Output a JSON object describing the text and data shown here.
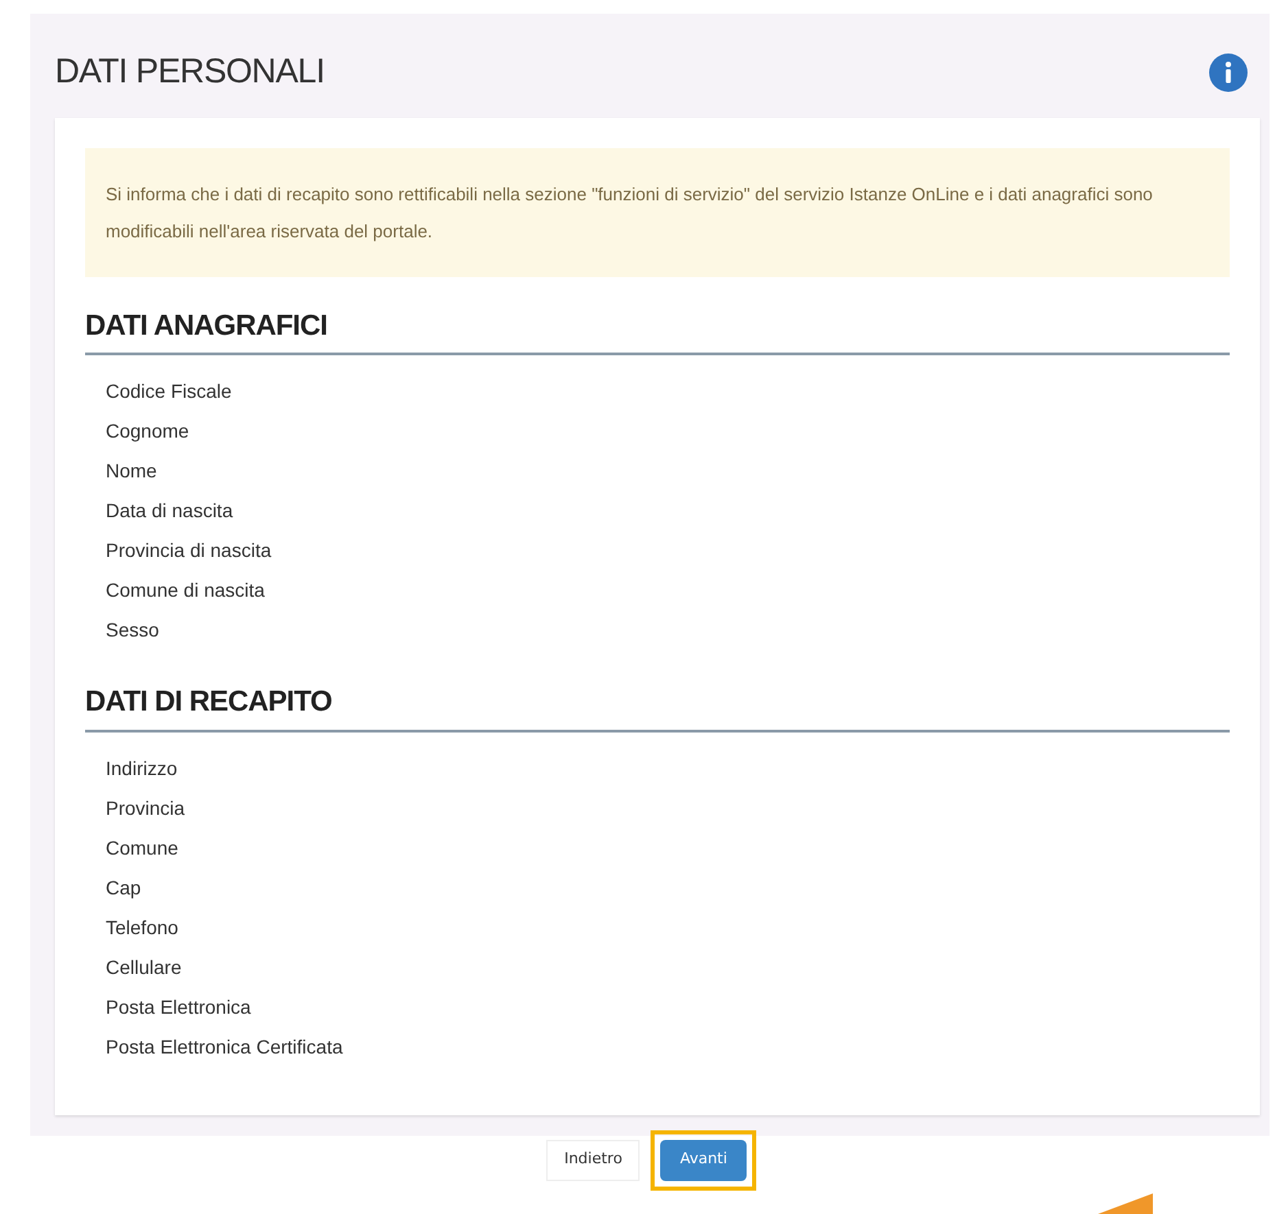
{
  "panel": {
    "title": "DATI PERSONALI"
  },
  "notice": "Si informa che i dati di recapito sono rettificabili nella sezione \"funzioni di servizio\" del servizio Istanze OnLine e i dati anagrafici sono modificabili nell'area riservata del portale.",
  "sections": [
    {
      "heading": "DATI ANAGRAFICI",
      "fields": [
        "Codice Fiscale",
        "Cognome",
        "Nome",
        "Data di nascita",
        "Provincia di nascita",
        "Comune di nascita",
        "Sesso"
      ]
    },
    {
      "heading": "DATI DI RECAPITO",
      "fields": [
        "Indirizzo",
        "Provincia",
        "Comune",
        "Cap",
        "Telefono",
        "Cellulare",
        "Posta Elettronica",
        "Posta Elettronica Certificata"
      ]
    }
  ],
  "buttons": [
    {
      "label": "Indietro",
      "kind": "secondary"
    },
    {
      "label": "Avanti",
      "kind": "primary"
    }
  ]
}
